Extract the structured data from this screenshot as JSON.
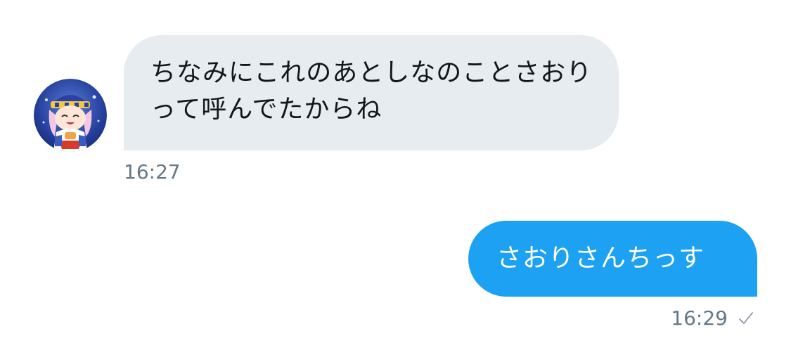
{
  "conversation": {
    "incoming": {
      "avatar_icon": "anime-character-avatar-icon",
      "text": "ちなみにこれのあとしなのことさおりって呼んでたからね",
      "time": "16:27"
    },
    "outgoing": {
      "text": "さおりさんちっす",
      "time": "16:29",
      "status_icon": "read-check-icon"
    }
  },
  "colors": {
    "incoming_bubble": "#e6ecf0",
    "outgoing_bubble": "#1da1f2",
    "timestamp": "#657786",
    "text_dark": "#14171a"
  }
}
